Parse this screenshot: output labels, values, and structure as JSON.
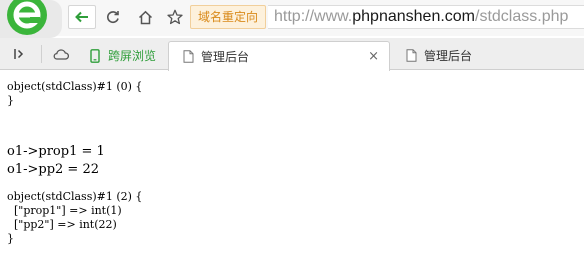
{
  "toolbar": {
    "redirect_badge": "域名重定向",
    "url": {
      "prefix": "http://www.",
      "host": "phpnanshen.com",
      "path": "/stdclass.php"
    }
  },
  "tabs": [
    {
      "label": "跨屏浏览",
      "icon": "phone-icon"
    },
    {
      "label": "管理后台",
      "icon": "page-icon",
      "close": "×"
    },
    {
      "label": "管理后台",
      "icon": "page-icon"
    }
  ],
  "content": {
    "dump1": "object(stdClass)#1 (0) {\n}",
    "line1": "o1->prop1 = 1",
    "line2": "o1->pp2 = 22",
    "dump2": "object(stdClass)#1 (2) {\n  [\"prop1\"] => int(1)\n  [\"pp2\"] => int(22)\n}"
  },
  "colors": {
    "logo_green": "#3bb53b",
    "nav_green": "#2f9e3a",
    "badge_orange": "#d98a1a"
  }
}
